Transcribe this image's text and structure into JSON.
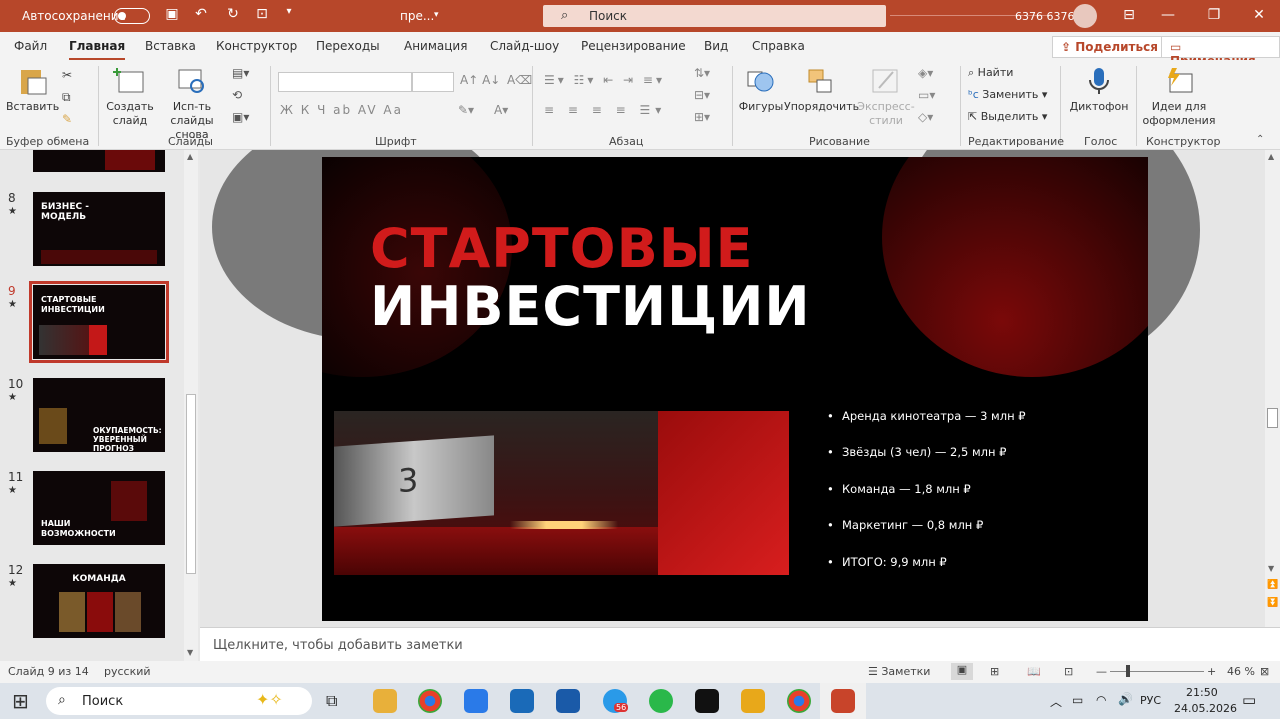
{
  "titlebar": {
    "autosave": "Автосохранение",
    "doc": "пре...",
    "search": "Поиск",
    "user": "6376 6376"
  },
  "tabs": [
    "Файл",
    "Главная",
    "Вставка",
    "Конструктор",
    "Переходы",
    "Анимация",
    "Слайд-шоу",
    "Рецензирование",
    "Вид",
    "Справка"
  ],
  "actions": {
    "share": "Поделиться",
    "comments": "Примечания"
  },
  "ribbon": {
    "paste": "Вставить",
    "new_slide": "Создать слайд",
    "reuse": "Исп-ть слайды снова",
    "shapes": "Фигуры",
    "arrange": "Упорядочить",
    "styles": "Экспресс-стили",
    "find": "Найти",
    "replace": "Заменить",
    "select": "Выделить",
    "dictate": "Диктофон",
    "design": "Идеи для оформления",
    "font_btns": "Ж К Ч ab AV Aa",
    "groups": [
      "Буфер обмена",
      "Слайды",
      "Шрифт",
      "Абзац",
      "Рисование",
      "Редактирование",
      "Голос",
      "Конструктор"
    ]
  },
  "thumbnails": [
    {
      "num": "8",
      "title": "БИЗНЕС - МОДЕЛЬ"
    },
    {
      "num": "9",
      "title": "СТАРТОВЫЕ ИНВЕСТИЦИИ"
    },
    {
      "num": "10",
      "title": "ОКУПАЕМОСТЬ: УВЕРЕННЫЙ ПРОГНОЗ"
    },
    {
      "num": "11",
      "title": "НАШИ ВОЗМОЖНОСТИ"
    },
    {
      "num": "12",
      "title": "КОМАНДА"
    }
  ],
  "slide": {
    "title_line1": "СТАРТОВЫЕ",
    "title_line2": "ИНВЕСТИЦИИ",
    "screen_text": "3",
    "bullets": [
      "Аренда кинотеатра — 3 млн ₽",
      "Звёзды (3 чел) — 2,5 млн ₽",
      "Команда — 1,8 млн ₽",
      "Маркетинг — 0,8 млн ₽",
      "ИТОГО: 9,9 млн ₽"
    ]
  },
  "notes_placeholder": "Щелкните, чтобы добавить заметки",
  "status": {
    "slide": "Слайд 9 из 14",
    "lang": "русский",
    "notes": "Заметки",
    "zoom": "46 %"
  },
  "taskbar": {
    "search": "Поиск",
    "lang": "РУС",
    "time": "21:50",
    "date": "24.05.2026",
    "badge": "56"
  },
  "colors": {
    "accent": "#b7472a",
    "slide_red": "#d11b1b"
  }
}
